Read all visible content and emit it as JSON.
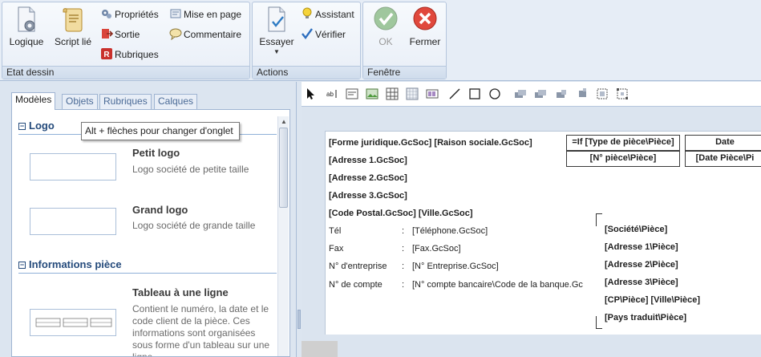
{
  "ribbon": {
    "groups": [
      {
        "label": "Etat dessin",
        "big_buttons": [
          {
            "label": "Logique",
            "icon": "document-gear-icon"
          },
          {
            "label": "Script lié",
            "icon": "scroll-script-icon"
          }
        ],
        "small_buttons": [
          {
            "label": "Propriétés",
            "icon": "gears-properties-icon"
          },
          {
            "label": "Sortie",
            "icon": "exit-arrow-icon"
          },
          {
            "label": "Rubriques",
            "icon": "fields-r-icon"
          },
          {
            "label": "Mise en page",
            "icon": "page-setup-icon"
          },
          {
            "label": "Commentaire",
            "icon": "comment-icon"
          }
        ]
      },
      {
        "label": "Actions",
        "big_buttons": [
          {
            "label": "Essayer",
            "icon": "document-check-icon"
          }
        ],
        "small_buttons": [
          {
            "label": "Assistant",
            "icon": "lightbulb-icon"
          },
          {
            "label": "Vérifier",
            "icon": "checkmark-icon"
          }
        ]
      },
      {
        "label": "Fenêtre",
        "big_buttons": [
          {
            "label": "OK",
            "icon": "ok-check-icon",
            "disabled": true
          },
          {
            "label": "Fermer",
            "icon": "close-x-icon"
          }
        ]
      }
    ]
  },
  "left_panel": {
    "tabs": [
      "Modèles",
      "Objets",
      "Rubriques",
      "Calques"
    ],
    "active_tab": "Modèles",
    "tooltip": "Alt + flèches pour changer d'onglet",
    "sections": [
      {
        "title": "Logo",
        "items": [
          {
            "title": "Petit logo",
            "desc": "Logo société de petite taille"
          },
          {
            "title": "Grand logo",
            "desc": "Logo société de grande taille"
          }
        ]
      },
      {
        "title": "Informations pièce",
        "items": [
          {
            "title": "Tableau à une ligne",
            "desc": "Contient le numéro, la date et le code client de la pièce. Ces informations sont organisées sous forme d'un tableau sur une ligne."
          }
        ]
      }
    ]
  },
  "designer": {
    "fields_left": [
      "[Forme juridique.GcSoc] [Raison sociale.GcSoc]",
      "[Adresse 1.GcSoc]",
      "[Adresse 2.GcSoc]",
      "[Adresse 3.GcSoc]",
      "[Code Postal.GcSoc] [Ville.GcSoc]"
    ],
    "contact_rows": [
      {
        "label": "Tél",
        "sep": ":",
        "value": "[Téléphone.GcSoc]"
      },
      {
        "label": "Fax",
        "sep": ":",
        "value": "[Fax.GcSoc]"
      },
      {
        "label": "N° d'entreprise",
        "sep": ":",
        "value": "[N° Entreprise.GcSoc]"
      },
      {
        "label": "N° de compte",
        "sep": ":",
        "value": "[N° compte bancaire\\Code de la banque.Gc"
      }
    ],
    "header_table": {
      "col1_top": "=If [Type de pièce\\Pièce]",
      "col1_bottom": "[N° pièce\\Pièce]",
      "col2_top": "Date",
      "col2_bottom": "[Date Pièce\\Pi"
    },
    "address_block": [
      "[Société\\Pièce]",
      "[Adresse 1\\Pièce]",
      "[Adresse 2\\Pièce]",
      "[Adresse 3\\Pièce]",
      "[CP\\Pièce] [Ville\\Pièce]",
      "[Pays traduit\\Pièce]"
    ]
  }
}
